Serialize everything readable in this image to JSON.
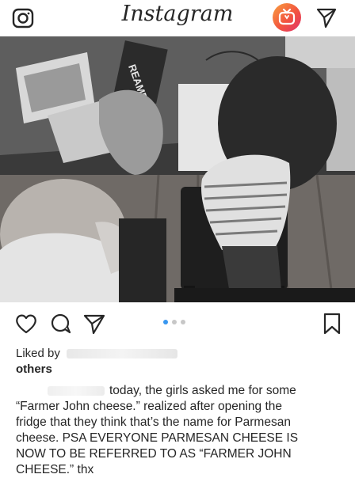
{
  "header": {
    "logo_text": "Instagram",
    "camera_icon": "camera-icon",
    "igtv_icon": "igtv-icon",
    "direct_icon": "paper-plane-icon"
  },
  "post": {
    "photo_description_icon": "photo",
    "actions": {
      "like_icon": "heart-icon",
      "comment_icon": "comment-icon",
      "share_icon": "paper-plane-icon",
      "save_icon": "bookmark-icon"
    },
    "carousel": {
      "count": 3,
      "active_index": 0
    },
    "liked_by_label": "Liked by",
    "others_label": "others",
    "caption_lines": [
      "today, the girls asked me for some",
      "“Farmer John cheese.” realized after opening the",
      "fridge that they think that’s the name for Parmesan",
      "cheese. PSA EVERYONE PARMESAN CHEESE IS",
      "NOW TO BE REFERRED TO AS “FARMER JOHN",
      "CHEESE.” thx"
    ]
  },
  "colors": {
    "accent": "#3897f0",
    "text": "#262626",
    "igtv_gradient_start": "#f9a03f",
    "igtv_gradient_end": "#e1306c"
  }
}
